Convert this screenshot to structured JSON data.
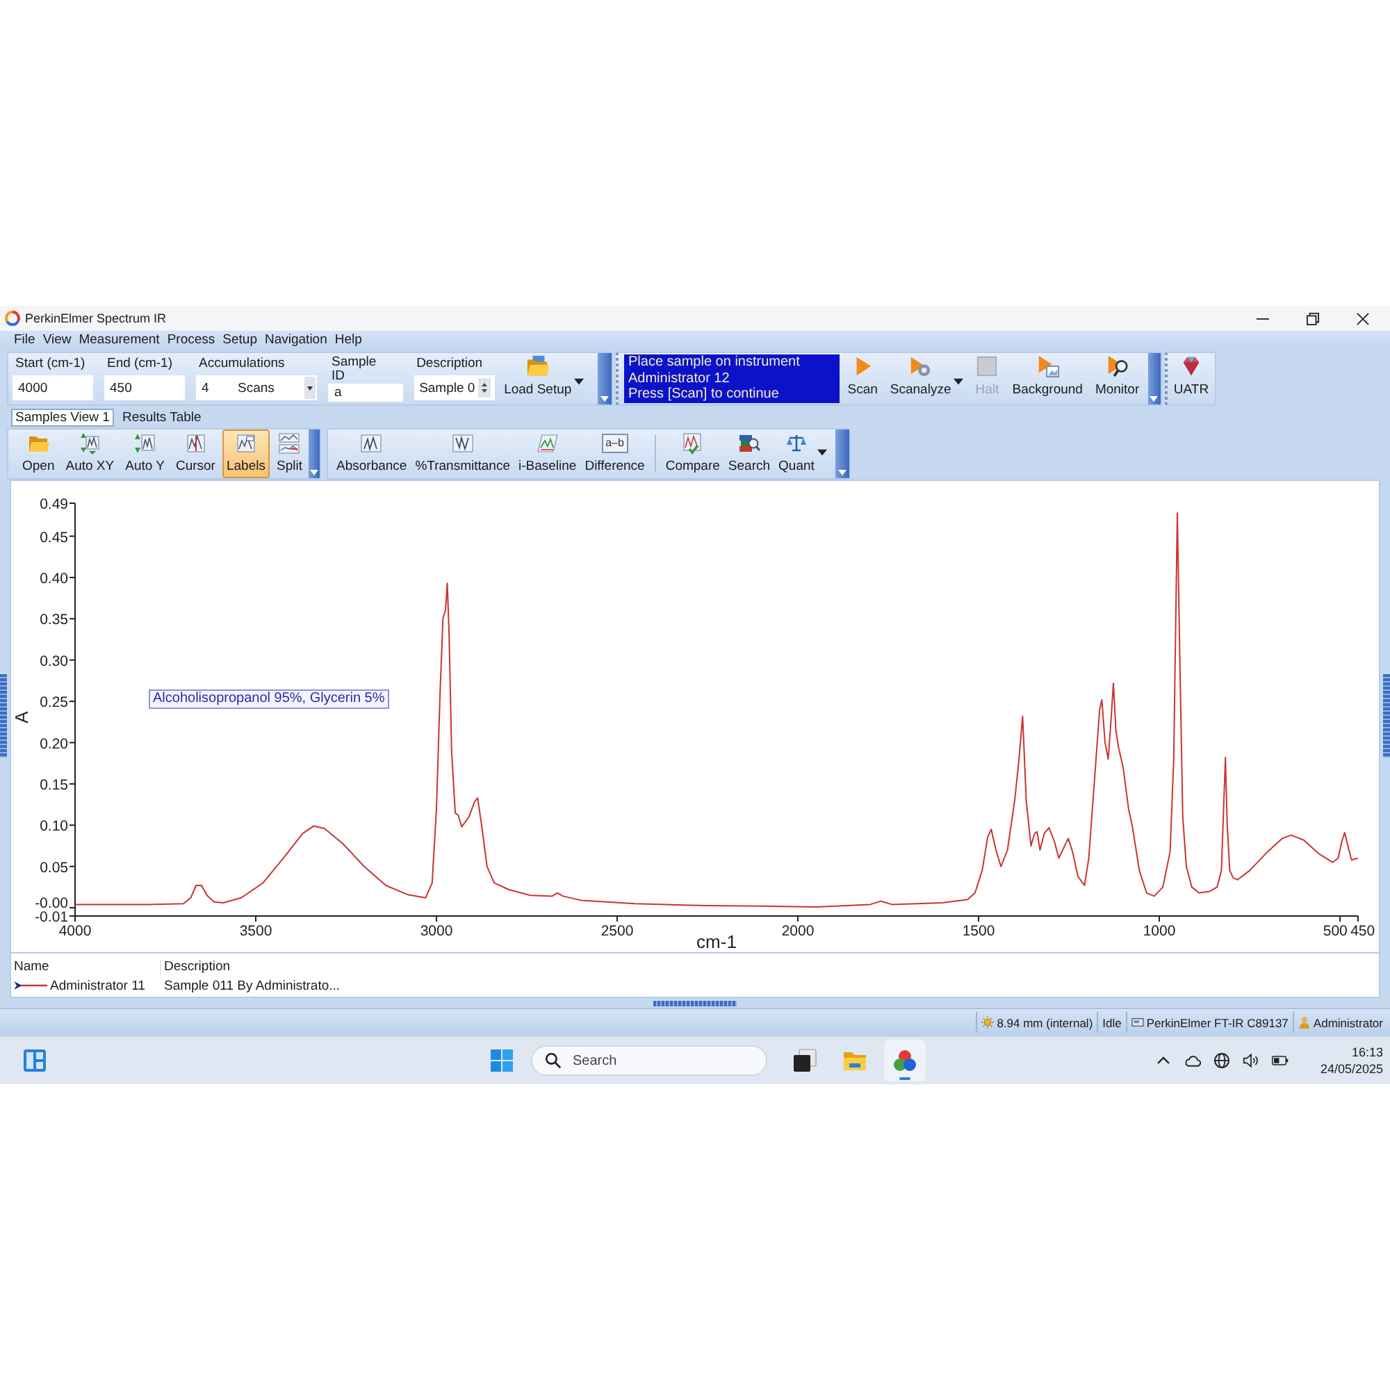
{
  "window": {
    "title": "PerkinElmer Spectrum IR"
  },
  "menu": [
    {
      "label": "File"
    },
    {
      "label": "View"
    },
    {
      "label": "Measurement"
    },
    {
      "label": "Process"
    },
    {
      "label": "Setup"
    },
    {
      "label": "Navigation"
    },
    {
      "label": "Help"
    }
  ],
  "setup_toolbar": {
    "fields": [
      {
        "kind": "text",
        "label": "Start (cm-1)",
        "value": "4000"
      },
      {
        "kind": "text",
        "label": "End (cm-1)",
        "value": "450"
      },
      {
        "kind": "dropdown",
        "label": "Accumulations",
        "value": "4",
        "unit": "Scans"
      },
      {
        "kind": "text",
        "label": "Sample ID",
        "value": "a"
      },
      {
        "kind": "spin",
        "label": "Description",
        "value": "Sample 0"
      }
    ],
    "buttons": [
      {
        "label": "Load Setup",
        "dropdown": true
      }
    ]
  },
  "status_message": {
    "lines": [
      "Place sample on instrument",
      "Administrator 12",
      "Press [Scan] to continue"
    ]
  },
  "scan_toolbar": {
    "buttons": [
      {
        "label": "Scan",
        "disabled": false,
        "dropdown": false
      },
      {
        "label": "Scanalyze",
        "disabled": false,
        "dropdown": true
      },
      {
        "label": "Halt",
        "disabled": true,
        "dropdown": false
      },
      {
        "label": "Background",
        "disabled": false,
        "dropdown": false
      },
      {
        "label": "Monitor",
        "disabled": false,
        "dropdown": false
      }
    ]
  },
  "accessory_toolbar": {
    "buttons": [
      {
        "label": "UATR"
      }
    ]
  },
  "tabs": [
    {
      "label": "Samples View 1",
      "selected": true
    },
    {
      "label": "Results Table",
      "selected": false
    }
  ],
  "view_toolbar": {
    "buttons": [
      {
        "label": "Open",
        "on": false
      },
      {
        "label": "Auto XY",
        "on": false
      },
      {
        "label": "Auto Y",
        "on": false
      },
      {
        "label": "Cursor",
        "on": false
      },
      {
        "label": "Labels",
        "on": true
      },
      {
        "label": "Split",
        "on": false
      }
    ]
  },
  "process_toolbar": {
    "groups": [
      {
        "buttons": [
          {
            "label": "Absorbance",
            "dropdown": false
          },
          {
            "label": "%Transmittance",
            "dropdown": false
          },
          {
            "label": "i-Baseline",
            "dropdown": false
          },
          {
            "label": "Difference",
            "dropdown": false,
            "icon_text": "a–b"
          }
        ]
      },
      {
        "buttons": [
          {
            "label": "Compare",
            "dropdown": false
          },
          {
            "label": "Search",
            "dropdown": false
          },
          {
            "label": "Quant",
            "dropdown": true
          }
        ]
      }
    ]
  },
  "spectrum_view": {
    "chart_data": {
      "type": "line",
      "xlabel": "cm-1",
      "ylabel": "A",
      "x": [
        4000,
        3800,
        3700,
        3680,
        3665,
        3650,
        3635,
        3615,
        3590,
        3540,
        3480,
        3420,
        3370,
        3340,
        3310,
        3260,
        3200,
        3140,
        3080,
        3030,
        3012,
        3000,
        2990,
        2982,
        2975,
        2970,
        2965,
        2958,
        2948,
        2940,
        2930,
        2910,
        2895,
        2886,
        2875,
        2860,
        2840,
        2800,
        2740,
        2680,
        2665,
        2650,
        2600,
        2450,
        2300,
        2100,
        1950,
        1800,
        1770,
        1740,
        1600,
        1530,
        1510,
        1490,
        1475,
        1465,
        1452,
        1438,
        1420,
        1400,
        1388,
        1378,
        1368,
        1355,
        1345,
        1338,
        1330,
        1318,
        1305,
        1290,
        1278,
        1265,
        1252,
        1240,
        1225,
        1207,
        1195,
        1180,
        1165,
        1159,
        1150,
        1141,
        1133,
        1127,
        1120,
        1113,
        1100,
        1085,
        1075,
        1055,
        1035,
        1014,
        990,
        970,
        960,
        950,
        943,
        935,
        925,
        910,
        890,
        860,
        840,
        828,
        817,
        812,
        805,
        795,
        783,
        750,
        700,
        660,
        635,
        600,
        560,
        520,
        505,
        495,
        487,
        478,
        468,
        450
      ],
      "series": [
        {
          "name": "Administrator 11",
          "color": "#cc3333",
          "values": [
            0.004,
            0.004,
            0.005,
            0.012,
            0.027,
            0.027,
            0.015,
            0.007,
            0.006,
            0.012,
            0.03,
            0.062,
            0.09,
            0.099,
            0.096,
            0.078,
            0.05,
            0.027,
            0.016,
            0.012,
            0.03,
            0.12,
            0.26,
            0.351,
            0.36,
            0.393,
            0.33,
            0.19,
            0.115,
            0.112,
            0.098,
            0.11,
            0.128,
            0.133,
            0.1,
            0.05,
            0.03,
            0.022,
            0.015,
            0.014,
            0.018,
            0.014,
            0.009,
            0.005,
            0.003,
            0.002,
            0.001,
            0.004,
            0.008,
            0.004,
            0.006,
            0.01,
            0.018,
            0.045,
            0.085,
            0.095,
            0.07,
            0.05,
            0.07,
            0.13,
            0.18,
            0.232,
            0.13,
            0.075,
            0.09,
            0.092,
            0.07,
            0.09,
            0.097,
            0.08,
            0.06,
            0.072,
            0.084,
            0.068,
            0.038,
            0.027,
            0.06,
            0.15,
            0.24,
            0.252,
            0.2,
            0.18,
            0.23,
            0.272,
            0.215,
            0.195,
            0.17,
            0.12,
            0.1,
            0.045,
            0.018,
            0.014,
            0.025,
            0.068,
            0.18,
            0.478,
            0.3,
            0.11,
            0.05,
            0.025,
            0.018,
            0.02,
            0.025,
            0.045,
            0.182,
            0.1,
            0.045,
            0.036,
            0.034,
            0.045,
            0.068,
            0.084,
            0.088,
            0.082,
            0.066,
            0.055,
            0.06,
            0.08,
            0.091,
            0.075,
            0.058,
            0.06
          ]
        }
      ],
      "xlim": [
        4000,
        450
      ],
      "ylim": [
        -0.01,
        0.49
      ],
      "xticks": [
        4000,
        3500,
        3000,
        2500,
        2000,
        1500,
        1000,
        500,
        450
      ],
      "yticks": [
        0.49,
        0.45,
        {
          "value": 0.4,
          "label": "0.40"
        },
        0.35,
        {
          "value": 0.3,
          "label": "0.30"
        },
        0.25,
        {
          "value": 0.2,
          "label": "0.20"
        },
        0.15,
        {
          "value": 0.1,
          "label": "0.10"
        },
        0.05,
        {
          "value": 0,
          "label": "-0.00"
        },
        -0.01
      ],
      "annotations": [
        "Alcoholisopropanol 95%, Glycerin 5%"
      ]
    }
  },
  "legend": {
    "columns": [
      "Name",
      "Description"
    ],
    "rows": [
      {
        "description": "Sample 011 By Administrato..."
      }
    ]
  },
  "status_bar": {
    "items": [
      {
        "kind": "lamp",
        "text": "8.94 mm (internal)"
      },
      {
        "kind": "plain",
        "text": "Idle"
      },
      {
        "kind": "instrument",
        "text": "PerkinElmer FT-IR C89137"
      },
      {
        "kind": "user",
        "text": "Administrator"
      }
    ]
  },
  "taskbar": {
    "search": {
      "placeholder": "Search"
    },
    "apps": [
      {
        "running": false
      },
      {
        "running": false
      },
      {
        "running": true
      }
    ],
    "clock": {
      "time": "16:13",
      "date": "24/05/2025"
    }
  }
}
